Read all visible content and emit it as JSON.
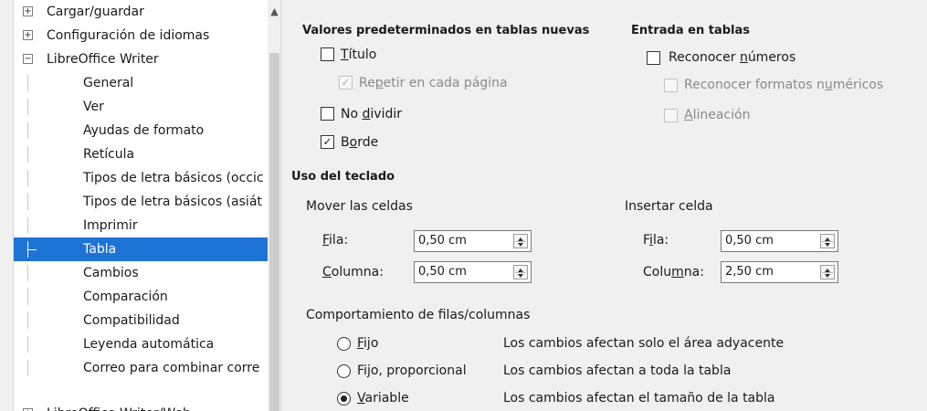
{
  "tree": {
    "items": [
      {
        "label": "Cargar/guardar",
        "level": 0,
        "expander": "+"
      },
      {
        "label": "Configuración de idiomas",
        "level": 0,
        "expander": "+"
      },
      {
        "label": "LibreOffice Writer",
        "level": 0,
        "expander": "−"
      },
      {
        "label": "General",
        "level": 1
      },
      {
        "label": "Ver",
        "level": 1
      },
      {
        "label": "Ayudas de formato",
        "level": 1
      },
      {
        "label": "Retícula",
        "level": 1
      },
      {
        "label": "Tipos de letra básicos (occic",
        "level": 1
      },
      {
        "label": "Tipos de letra básicos (asiát",
        "level": 1
      },
      {
        "label": "Imprimir",
        "level": 1
      },
      {
        "label": "Tabla",
        "level": 1,
        "selected": true
      },
      {
        "label": "Cambios",
        "level": 1
      },
      {
        "label": "Comparación",
        "level": 1
      },
      {
        "label": "Compatibilidad",
        "level": 1
      },
      {
        "label": "Leyenda automática",
        "level": 1
      },
      {
        "label": "Correo para combinar corre",
        "level": 1
      },
      {
        "label": "LibreOffice Writer/Web",
        "level": 0,
        "expander": "+"
      }
    ],
    "scroll_up_icon": "▲"
  },
  "defaults": {
    "heading": "Valores predeterminados en tablas nuevas",
    "titulo": {
      "pre": "",
      "ul": "T",
      "post": "ítulo",
      "checked": false
    },
    "repetir": {
      "pre": "Re",
      "ul": "p",
      "post": "etir en cada página",
      "checked": true,
      "disabled": true
    },
    "nodividir": {
      "pre": "No ",
      "ul": "d",
      "post": "ividir",
      "checked": false
    },
    "borde": {
      "pre": "B",
      "ul": "o",
      "post": "rde",
      "checked": true
    }
  },
  "input": {
    "heading": "Entrada en tablas",
    "reconocer_numeros": {
      "pre": "Reconocer ",
      "ul": "n",
      "post": "úmeros",
      "checked": false
    },
    "reconocer_formatos": {
      "pre": "Reconocer formatos n",
      "ul": "u",
      "post": "méricos",
      "checked": false,
      "disabled": true
    },
    "alineacion": {
      "pre": "",
      "ul": "A",
      "post": "lineación",
      "checked": false,
      "disabled": true
    }
  },
  "keyboard": {
    "heading": "Uso del teclado",
    "move": {
      "label": "Mover las celdas",
      "fila": {
        "pre": "",
        "ul": "F",
        "post": "ila:",
        "value": "0,50 cm"
      },
      "columna": {
        "pre": "",
        "ul": "C",
        "post": "olumna:",
        "value": "0,50 cm"
      }
    },
    "insert": {
      "label": "Insertar celda",
      "fila": {
        "pre": "F",
        "ul": "i",
        "post": "la:",
        "value": "0,50 cm"
      },
      "columna": {
        "pre": "Colu",
        "ul": "m",
        "post": "na:",
        "value": "2,50 cm"
      }
    }
  },
  "behavior": {
    "label": "Comportamiento de filas/columnas",
    "options": [
      {
        "pre": "",
        "ul": "F",
        "post": "ijo",
        "desc": "Los cambios afectan solo el área adyacente",
        "selected": false
      },
      {
        "pre": "Fi",
        "ul": "j",
        "post": "o, proporcional",
        "desc": "Los cambios afectan a toda la tabla",
        "selected": false
      },
      {
        "pre": "",
        "ul": "V",
        "post": "ariable",
        "desc": "Los cambios afectan el tamaño de la tabla",
        "selected": true
      }
    ]
  },
  "colors": {
    "selection": "#1e73d6",
    "background": "#f0f0f0"
  },
  "icons": {
    "check": "✓",
    "expand": "+",
    "collapse": "−"
  }
}
